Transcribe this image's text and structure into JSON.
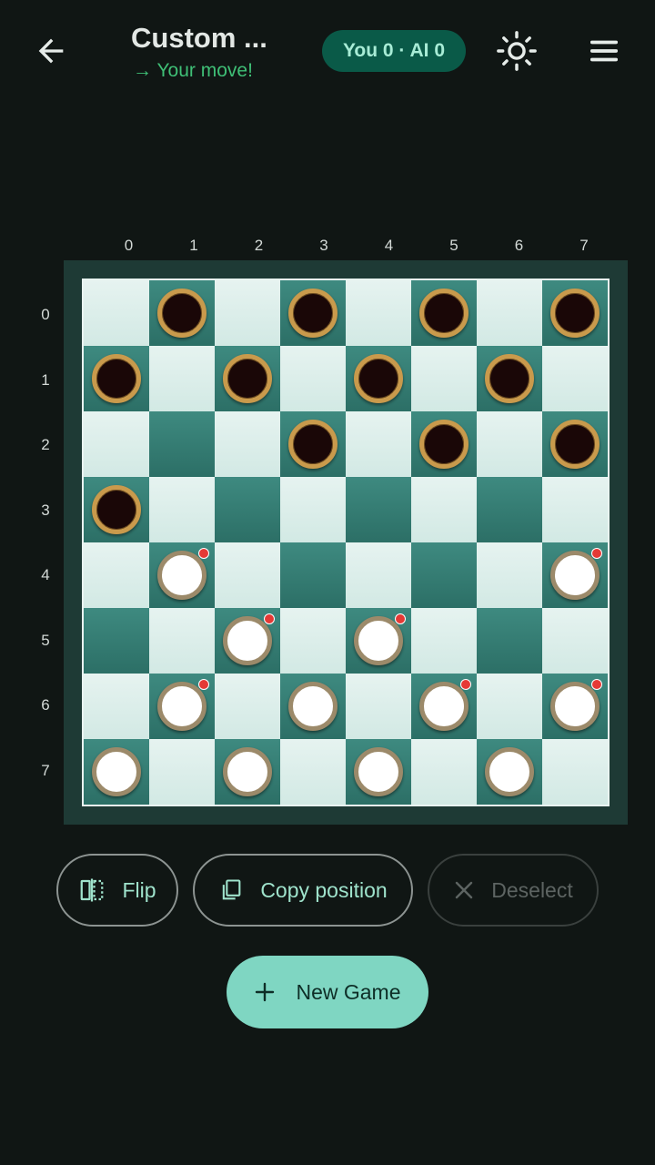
{
  "header": {
    "title": "Custom ...",
    "subtitle": "→ Your move!",
    "score": "You 0 · AI 0",
    "back_icon": "arrow-left-icon",
    "theme_icon": "sun-icon",
    "menu_icon": "hamburger-menu-icon"
  },
  "board": {
    "col_labels": [
      "0",
      "1",
      "2",
      "3",
      "4",
      "5",
      "6",
      "7"
    ],
    "row_labels": [
      "0",
      "1",
      "2",
      "3",
      "4",
      "5",
      "6",
      "7"
    ],
    "rows": [
      ". b . b . b . b",
      "b . b . b . b .",
      ". . . b . b . b",
      "b . . . . . . .",
      ". W . . . . . W",
      ". . W . W . . .",
      ". W . w . W . W",
      "w . w . w . w ."
    ],
    "legend": {
      "b": "black piece",
      "w": "white piece",
      "W": "white piece, movable (red dot)",
      ".": "empty"
    }
  },
  "buttons": {
    "flip": "Flip",
    "copy": "Copy position",
    "deselect": "Deselect",
    "new_game": "New Game"
  },
  "colors": {
    "background": "#101614",
    "accent": "#7fd6c2",
    "status_green": "#3fbf76",
    "score_pill": "#0a5a48",
    "board_frame": "#1e3a35",
    "light_square": "#dcefeb",
    "dark_square": "#357d73",
    "black_piece": "#1a0707",
    "black_ring": "#c99a4c",
    "white_piece": "#ffffff",
    "white_ring": "#9c8a6a",
    "move_dot": "#e53935"
  }
}
